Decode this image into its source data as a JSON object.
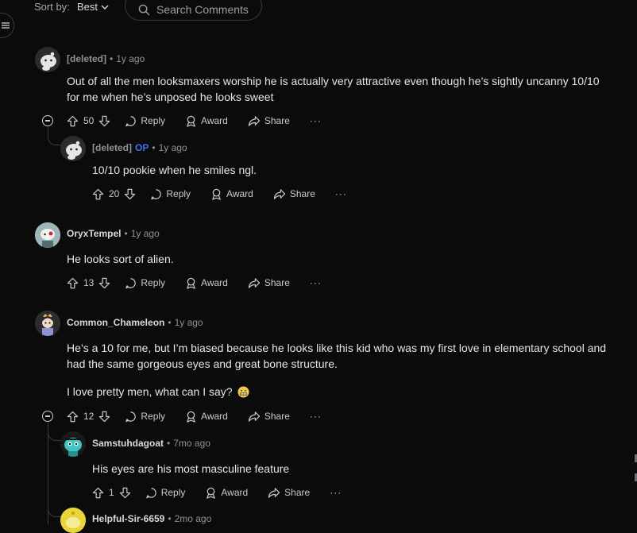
{
  "sort": {
    "label": "Sort by:",
    "value": "Best"
  },
  "search": {
    "placeholder": "Search Comments"
  },
  "actions": {
    "reply": "Reply",
    "award": "Award",
    "share": "Share",
    "more": "···"
  },
  "comments": [
    {
      "author": "[deleted]",
      "deleted": true,
      "time": "1y ago",
      "score": "50",
      "lines": [
        "Out of all the men looksmaxers worship he is actually very attractive even though he’s sightly uncanny 10/10",
        "for me when he’s unposed he looks sweet"
      ]
    },
    {
      "author": "[deleted]",
      "deleted": true,
      "op": "OP",
      "time": "1y ago",
      "score": "20",
      "lines": [
        "10/10 pookie when he smiles ngl."
      ]
    },
    {
      "author": "OryxTempel",
      "time": "1y ago",
      "score": "13",
      "lines": [
        "He looks sort of alien."
      ]
    },
    {
      "author": "Common_Chameleon",
      "time": "1y ago",
      "score": "12",
      "lines": [
        "He’s a 10 for me, but I’m biased because he looks like this kid who was my first love in elementary school and",
        "had the same gorgeous eyes and great bone structure."
      ],
      "extra": "I love pretty men, what can I say?"
    },
    {
      "author": "Samstuhdagoat",
      "time": "7mo ago",
      "score": "1",
      "lines": [
        "His eyes are his most masculine feature"
      ]
    },
    {
      "author": "Helpful-Sir-6659",
      "time": "2mo ago"
    }
  ],
  "colors": {
    "background": "#0b0b0b",
    "text": "#d7dadc",
    "muted": "#8e9296",
    "op": "#3c6ff2",
    "thread": "#3a3d3f"
  }
}
